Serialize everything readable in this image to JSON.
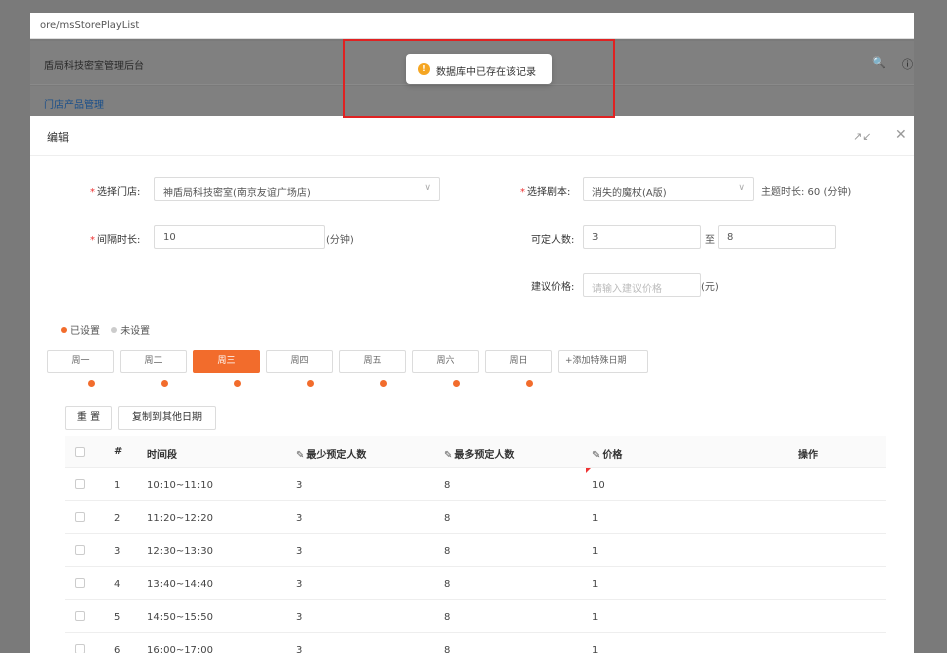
{
  "browser": {
    "url_fragment": "ore/msStorePlayList"
  },
  "app": {
    "title": "盾局科技密室管理后台",
    "search_icon": "search-icon",
    "help_icon": "help-icon"
  },
  "breadcrumb": {
    "current": "门店产品管理"
  },
  "toast": {
    "type": "warning",
    "message": "数据库中已存在该记录"
  },
  "modal": {
    "title": "编辑",
    "form": {
      "store_label": "选择门店:",
      "store_value": "神盾局科技密室(南京友谊广场店)",
      "interval_label": "间隔时长:",
      "interval_value": "10",
      "interval_unit": "(分钟)",
      "script_label": "选择剧本:",
      "script_value": "消失的魔杖(A版)",
      "theme_duration": "主题时长: 60 (分钟)",
      "capacity_label": "可定人数:",
      "capacity_min": "3",
      "capacity_to": "至",
      "capacity_max": "8",
      "price_label": "建议价格:",
      "price_placeholder": "请输入建议价格",
      "price_unit": "(元)"
    },
    "legend": {
      "set": "已设置",
      "unset": "未设置"
    },
    "days": [
      "周一",
      "周二",
      "周三",
      "周四",
      "周五",
      "周六",
      "周日"
    ],
    "active_day": "周三",
    "add_special_date": "+添加特殊日期",
    "buttons": {
      "reset": "重 置",
      "copy": "复制到其他日期"
    },
    "table": {
      "headers": [
        "#",
        "时间段",
        "最少预定人数",
        "最多预定人数",
        "价格",
        "操作"
      ],
      "rows": [
        {
          "index": "1",
          "time": "10:10~11:10",
          "min": "3",
          "max": "8",
          "price": "10"
        },
        {
          "index": "2",
          "time": "11:20~12:20",
          "min": "3",
          "max": "8",
          "price": "1"
        },
        {
          "index": "3",
          "time": "12:30~13:30",
          "min": "3",
          "max": "8",
          "price": "1"
        },
        {
          "index": "4",
          "time": "13:40~14:40",
          "min": "3",
          "max": "8",
          "price": "1"
        },
        {
          "index": "5",
          "time": "14:50~15:50",
          "min": "3",
          "max": "8",
          "price": "1"
        },
        {
          "index": "6",
          "time": "16:00~17:00",
          "min": "3",
          "max": "8",
          "price": "1"
        }
      ]
    }
  },
  "colors": {
    "accent": "#f26c2c",
    "overlay": "#808080",
    "highlight": "#e02222",
    "warning": "#f5a623"
  }
}
